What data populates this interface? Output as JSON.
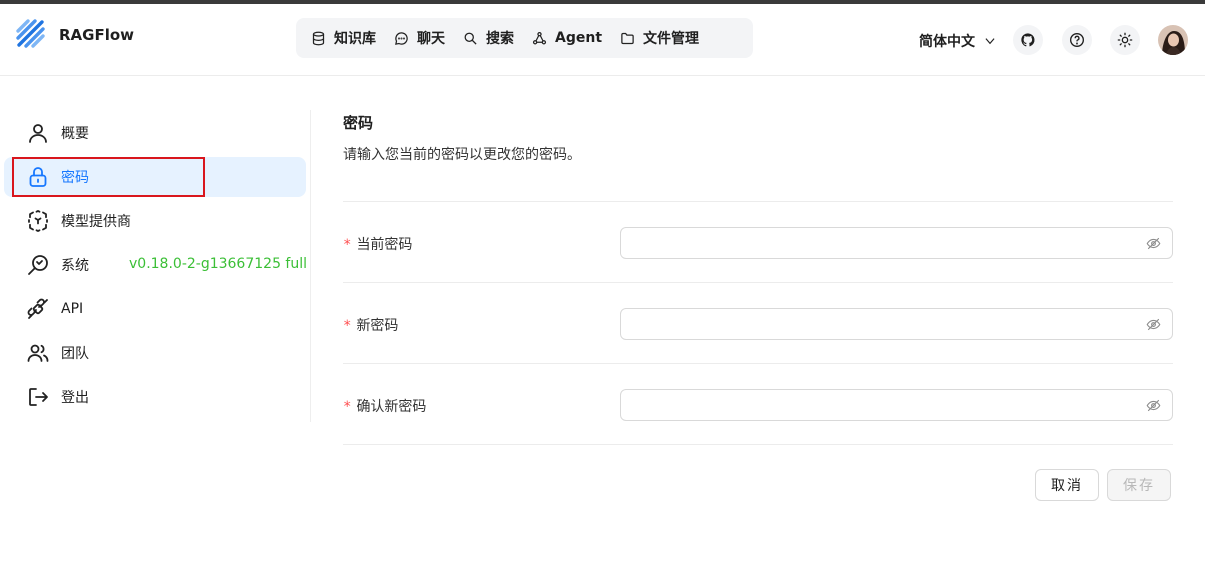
{
  "app": {
    "brand": "RAGFlow"
  },
  "nav": {
    "items": [
      {
        "label": "知识库",
        "icon": "database-icon"
      },
      {
        "label": "聊天",
        "icon": "chat-bubble-icon"
      },
      {
        "label": "搜索",
        "icon": "search-icon"
      },
      {
        "label": "Agent",
        "icon": "graph-nodes-icon"
      },
      {
        "label": "文件管理",
        "icon": "folder-icon"
      }
    ]
  },
  "header": {
    "language": "简体中文",
    "icons": [
      "github-icon",
      "help-circle-icon",
      "sun-icon",
      "avatar"
    ]
  },
  "sidebar": {
    "items": [
      {
        "label": "概要",
        "icon": "user-icon"
      },
      {
        "label": "密码",
        "icon": "lock-icon",
        "active": true
      },
      {
        "label": "模型提供商",
        "icon": "model-cube-icon"
      },
      {
        "label": "系统",
        "icon": "gauge-icon"
      },
      {
        "label": "API",
        "icon": "plug-icon"
      },
      {
        "label": "团队",
        "icon": "team-icon"
      },
      {
        "label": "登出",
        "icon": "logout-icon"
      }
    ],
    "version": "v0.18.0-2-g13667125 full"
  },
  "main": {
    "title": "密码",
    "subtitle": "请输入您当前的密码以更改您的密码。",
    "fields": [
      {
        "label": "当前密码",
        "required": true,
        "value": ""
      },
      {
        "label": "新密码",
        "required": true,
        "value": ""
      },
      {
        "label": "确认新密码",
        "required": true,
        "value": ""
      }
    ],
    "required_mark": "*",
    "cancel_label": "取消",
    "save_label": "保存"
  },
  "colors": {
    "accent": "#1677ff",
    "active_bg": "#e6f2ff",
    "version_green": "#3bbf36",
    "required_red": "#ff4d4f",
    "highlight_box": "#d9161d"
  }
}
